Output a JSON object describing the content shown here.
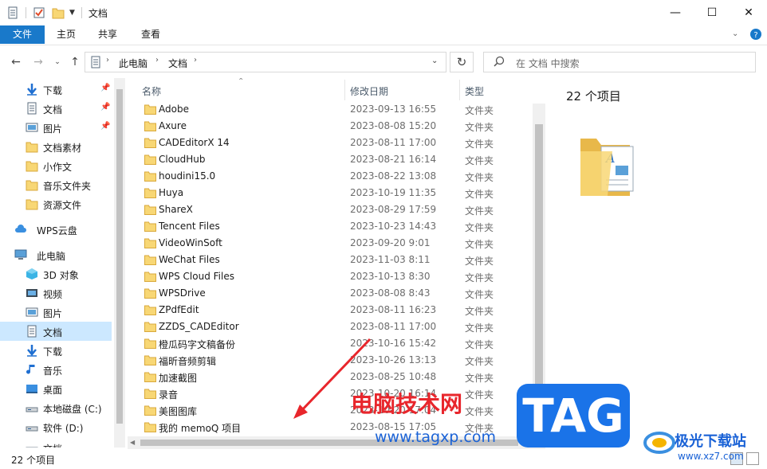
{
  "window": {
    "title": "文档",
    "buttons": {
      "minimize": "—",
      "maximize": "☐",
      "close": "✕"
    }
  },
  "ribbon": {
    "tabs": [
      "文件",
      "主页",
      "共享",
      "查看"
    ]
  },
  "nav": {
    "breadcrumb": [
      "此电脑",
      "文档"
    ],
    "search_placeholder": "在 文档 中搜索"
  },
  "sidebar": {
    "items": [
      {
        "label": "下载",
        "icon": "download-arrow-icon",
        "pinned": true
      },
      {
        "label": "文档",
        "icon": "document-icon",
        "pinned": true
      },
      {
        "label": "图片",
        "icon": "picture-icon",
        "pinned": true
      },
      {
        "label": "文档素材",
        "icon": "folder-icon",
        "pinned": false
      },
      {
        "label": "小作文",
        "icon": "folder-icon",
        "pinned": false
      },
      {
        "label": "音乐文件夹",
        "icon": "folder-icon",
        "pinned": false
      },
      {
        "label": "资源文件",
        "icon": "folder-icon",
        "pinned": false
      },
      {
        "label": "WPS云盘",
        "icon": "cloud-icon",
        "pinned": false
      },
      {
        "label": "此电脑",
        "icon": "computer-icon",
        "pinned": false
      },
      {
        "label": "3D 对象",
        "icon": "cube-3d-icon",
        "pinned": false
      },
      {
        "label": "视频",
        "icon": "video-icon",
        "pinned": false
      },
      {
        "label": "图片",
        "icon": "picture-icon",
        "pinned": false
      },
      {
        "label": "文档",
        "icon": "document-icon",
        "pinned": false,
        "selected": true
      },
      {
        "label": "下载",
        "icon": "download-arrow-icon",
        "pinned": false
      },
      {
        "label": "音乐",
        "icon": "music-note-icon",
        "pinned": false
      },
      {
        "label": "桌面",
        "icon": "desktop-icon",
        "pinned": false
      },
      {
        "label": "本地磁盘 (C:)",
        "icon": "drive-icon",
        "pinned": false
      },
      {
        "label": "软件 (D:)",
        "icon": "drive-icon",
        "pinned": false
      },
      {
        "label": "文档",
        "icon": "drive-icon",
        "pinned": false
      }
    ]
  },
  "filelist": {
    "columns": {
      "name": "名称",
      "date": "修改日期",
      "type": "类型"
    },
    "rows": [
      {
        "name": "Adobe",
        "date": "2023-09-13 16:55",
        "type": "文件夹"
      },
      {
        "name": "Axure",
        "date": "2023-08-08 15:20",
        "type": "文件夹"
      },
      {
        "name": "CADEditorX 14",
        "date": "2023-08-11 17:00",
        "type": "文件夹"
      },
      {
        "name": "CloudHub",
        "date": "2023-08-21 16:14",
        "type": "文件夹"
      },
      {
        "name": "houdini15.0",
        "date": "2023-08-22 13:08",
        "type": "文件夹"
      },
      {
        "name": "Huya",
        "date": "2023-10-19 11:35",
        "type": "文件夹"
      },
      {
        "name": "ShareX",
        "date": "2023-08-29 17:59",
        "type": "文件夹"
      },
      {
        "name": "Tencent Files",
        "date": "2023-10-23 14:43",
        "type": "文件夹"
      },
      {
        "name": "VideoWinSoft",
        "date": "2023-09-20 9:01",
        "type": "文件夹"
      },
      {
        "name": "WeChat Files",
        "date": "2023-11-03 8:11",
        "type": "文件夹"
      },
      {
        "name": "WPS Cloud Files",
        "date": "2023-10-13 8:30",
        "type": "文件夹"
      },
      {
        "name": "WPSDrive",
        "date": "2023-08-08 8:43",
        "type": "文件夹"
      },
      {
        "name": "ZPdfEdit",
        "date": "2023-08-11 16:23",
        "type": "文件夹"
      },
      {
        "name": "ZZDS_CADEditor",
        "date": "2023-08-11 17:00",
        "type": "文件夹"
      },
      {
        "name": "橙瓜码字文稿备份",
        "date": "2023-10-16 15:42",
        "type": "文件夹"
      },
      {
        "name": "福昕音频剪辑",
        "date": "2023-10-26 13:13",
        "type": "文件夹"
      },
      {
        "name": "加速截图",
        "date": "2023-08-25 10:48",
        "type": "文件夹"
      },
      {
        "name": "录音",
        "date": "2023-10-20 16:14",
        "type": "文件夹"
      },
      {
        "name": "美图图库",
        "date": "2023-10-20 17:04",
        "type": "文件夹"
      },
      {
        "name": "我的 memoQ 项目",
        "date": "2023-08-15 17:05",
        "type": "文件夹"
      }
    ]
  },
  "preview": {
    "count": "22 个项目"
  },
  "status": {
    "count": "22 个项目"
  },
  "watermark": {
    "brand": "电脑技术网",
    "tag": "TAG",
    "url": "www.tagxp.com",
    "site2": "极光下载站",
    "site2_url": "www.xz7.com"
  },
  "colors": {
    "file_tab": "#1979ca",
    "selection": "#cce8ff",
    "folder": "#f8d775",
    "watermark_red": "#e8262c",
    "tag_blue": "#1a73e8"
  }
}
